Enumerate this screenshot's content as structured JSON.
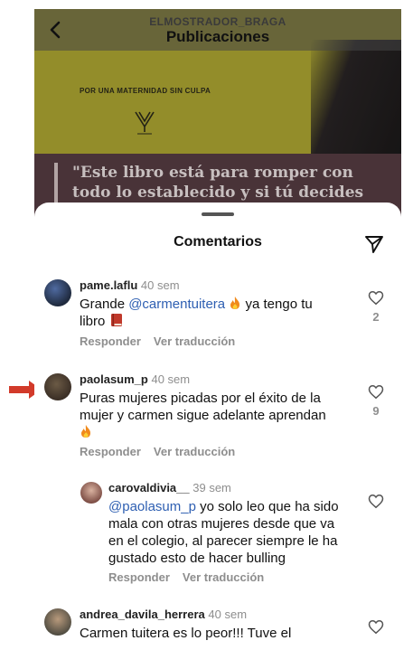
{
  "header": {
    "username": "ELMOSTRADOR_BRAGA",
    "title": "Publicaciones"
  },
  "post": {
    "caption": "POR UNA MATERNIDAD SIN CULPA",
    "quote": "\"Este libro está para romper con todo lo establecido y si tú decides"
  },
  "sheet": {
    "title": "Comentarios"
  },
  "colors": {
    "mention": "#2e5fb2",
    "arrow": "#d23a2a",
    "muted": "#8e8e8e"
  },
  "actions": {
    "reply": "Responder",
    "translate": "Ver traducción"
  },
  "comments": [
    {
      "user": "pame.laflu",
      "time": "40 sem",
      "text_prefix": "Grande ",
      "mention": "@carmentuitera",
      "text_suffix": " ya tengo tu",
      "text_line2": "libro",
      "likes": "2"
    },
    {
      "user": "paolasum_p",
      "time": "40 sem",
      "line1": "Puras mujeres picadas por el éxito de la",
      "line2": "mujer y carmen sigue adelante aprendan",
      "likes": "9"
    },
    {
      "user": "carovaldivia__",
      "time": "39 sem",
      "mention": "@paolasum_p",
      "line1_suffix": " yo solo leo que ha sido",
      "line2": "mala con otras mujeres desde que va",
      "line3": "en el colegio, al parecer siempre le ha",
      "line4": "gustado esto de hacer bulling"
    },
    {
      "user": "andrea_davila_herrera",
      "time": "40 sem",
      "line1": "Carmen tuitera es lo peor!!! Tuve el"
    }
  ]
}
